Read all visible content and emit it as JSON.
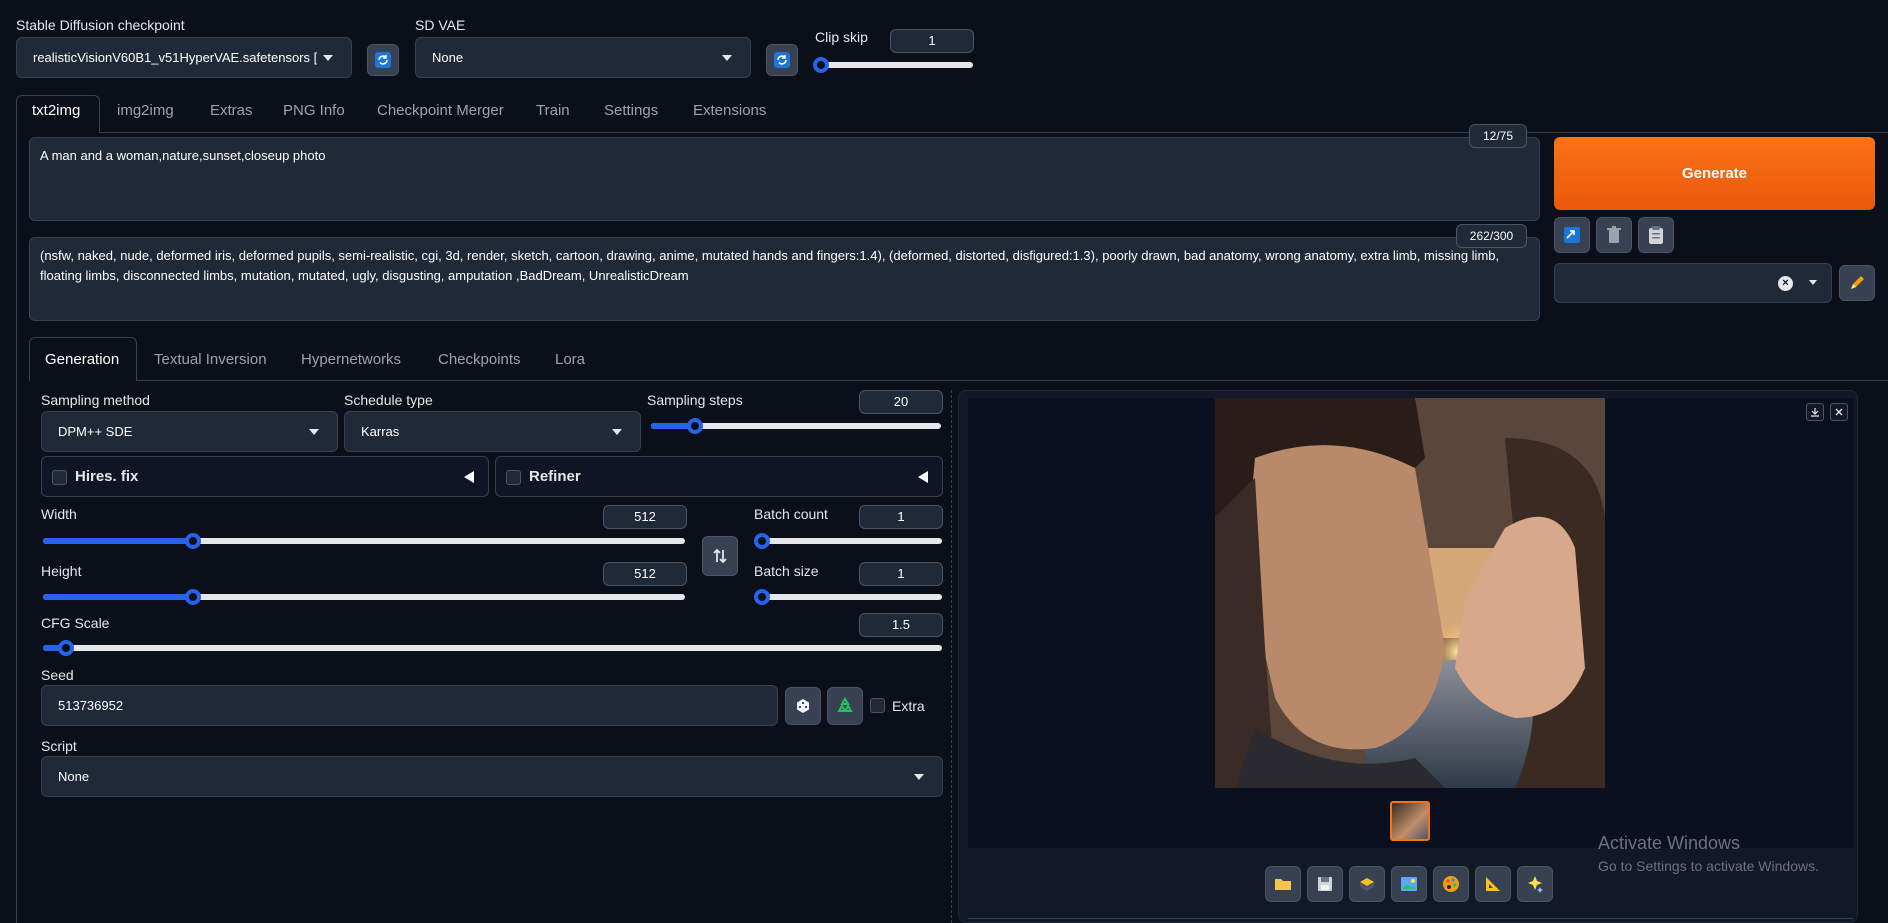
{
  "top": {
    "checkpoint_label": "Stable Diffusion checkpoint",
    "checkpoint_value": "realisticVisionV60B1_v51HyperVAE.safetensors [",
    "vae_label": "SD VAE",
    "vae_value": "None",
    "clipskip_label": "Clip skip",
    "clipskip_value": "1",
    "clipskip_fraction": 0.0
  },
  "tabs": [
    "txt2img",
    "img2img",
    "Extras",
    "PNG Info",
    "Checkpoint Merger",
    "Train",
    "Settings",
    "Extensions"
  ],
  "prompt": {
    "positive": "A man and a woman,nature,sunset,closeup photo",
    "positive_count": "12/75",
    "negative": "(nsfw, naked, nude, deformed iris, deformed pupils, semi-realistic, cgi, 3d, render, sketch, cartoon, drawing, anime, mutated hands and fingers:1.4), (deformed, distorted, disfigured:1.3), poorly drawn, bad anatomy, wrong anatomy, extra limb, missing limb, floating limbs, disconnected limbs, mutation, mutated, ugly, disgusting, amputation ,BadDream, UnrealisticDream",
    "negative_count": "262/300"
  },
  "generate_label": "Generate",
  "subtabs": [
    "Generation",
    "Textual Inversion",
    "Hypernetworks",
    "Checkpoints",
    "Lora"
  ],
  "params": {
    "sampling_method_label": "Sampling method",
    "sampling_method": "DPM++ SDE",
    "schedule_label": "Schedule type",
    "schedule": "Karras",
    "steps_label": "Sampling steps",
    "steps": "20",
    "steps_fraction": 0.15,
    "hires_label": "Hires. fix",
    "refiner_label": "Refiner",
    "width_label": "Width",
    "width": "512",
    "width_fraction": 0.234,
    "height_label": "Height",
    "height": "512",
    "height_fraction": 0.234,
    "batch_count_label": "Batch count",
    "batch_count": "1",
    "batch_size_label": "Batch size",
    "batch_size": "1",
    "cfg_label": "CFG Scale",
    "cfg": "1.5",
    "cfg_fraction": 0.026,
    "seed_label": "Seed",
    "seed": "513736952",
    "extra_label": "Extra",
    "script_label": "Script",
    "script": "None"
  },
  "watermark": {
    "title": "Activate Windows",
    "subtitle": "Go to Settings to activate Windows."
  },
  "colors": {
    "accent": "#2563eb",
    "generate": "#f97316"
  }
}
